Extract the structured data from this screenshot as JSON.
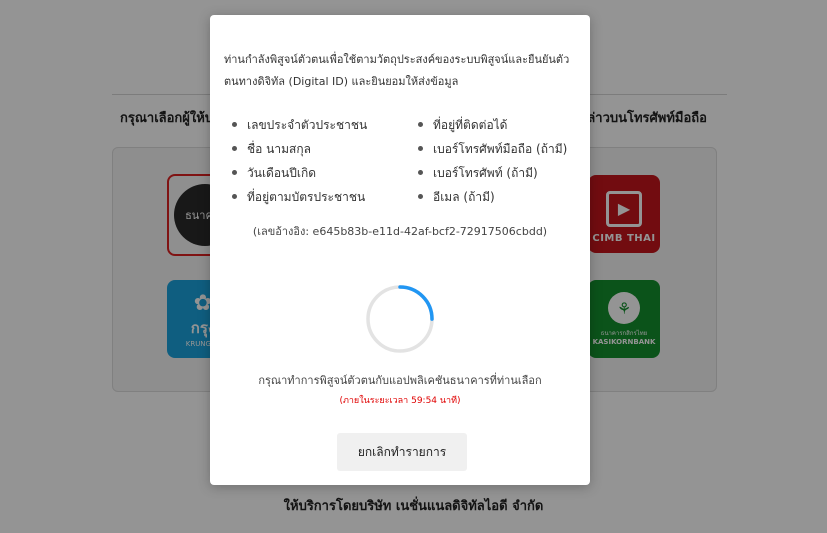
{
  "background": {
    "instruction_left": "กรุณาเลือกผู้ให้บริก",
    "instruction_right": "ดังกล่าวบนโทรศัพท์มือถือ",
    "banks": [
      {
        "id": "gsb",
        "label": "ธนาคาร",
        "icon": "gsb-logo-icon",
        "color": "#2a2a2a",
        "selected": true
      },
      {
        "id": "cimb",
        "label": "CIMB THAI",
        "icon": "cimb-logo-icon",
        "color": "#c4161c"
      },
      {
        "id": "ktb",
        "label": "กรุง",
        "sub": "KRUNGTH",
        "icon": "krungthai-logo-icon",
        "color": "#1aa3dc"
      },
      {
        "id": "kbank",
        "label": "ธนาคารกสิกรไทย",
        "sub": "KASIKORNBANK",
        "icon": "kasikorn-logo-icon",
        "color": "#138f2d"
      }
    ],
    "footer": "ให้บริการโดยบริษัท เนชั่นแนลดิจิทัลไอดี จำกัด"
  },
  "modal": {
    "consent_text": "ท่านกำลังพิสูจน์ตัวตนเพื่อใช้ตามวัตถุประสงค์ของระบบพิสูจน์และยืนยันตัวตนทางดิจิทัล (Digital ID) และยินยอมให้ส่งข้อมูล",
    "fields_left": [
      "เลขประจำตัวประชาชน",
      "ชื่อ นามสกุล",
      "วันเดือนปีเกิด",
      "ที่อยู่ตามบัตรประชาชน"
    ],
    "fields_right": [
      "ที่อยู่ที่ติดต่อได้",
      "เบอร์โทรศัพท์มือถือ (ถ้ามี)",
      "เบอร์โทรศัพท์ (ถ้ามี)",
      "อีเมล (ถ้ามี)"
    ],
    "reference": "(เลขอ้างอิง: e645b83b-e11d-42af-bcf2-72917506cbdd)",
    "instruction": "กรุณาทำการพิสูจน์ตัวตนกับแอปพลิเคชันธนาคารที่ท่านเลือก",
    "timer": "(ภายในระยะเวลา 59:54 นาที)",
    "cancel_label": "ยกเลิกทำรายการ",
    "spinner_progress": 0.25,
    "colors": {
      "spinner_track": "#e3e3e3",
      "spinner_arc": "#2196f3",
      "timer": "#e00000"
    }
  }
}
